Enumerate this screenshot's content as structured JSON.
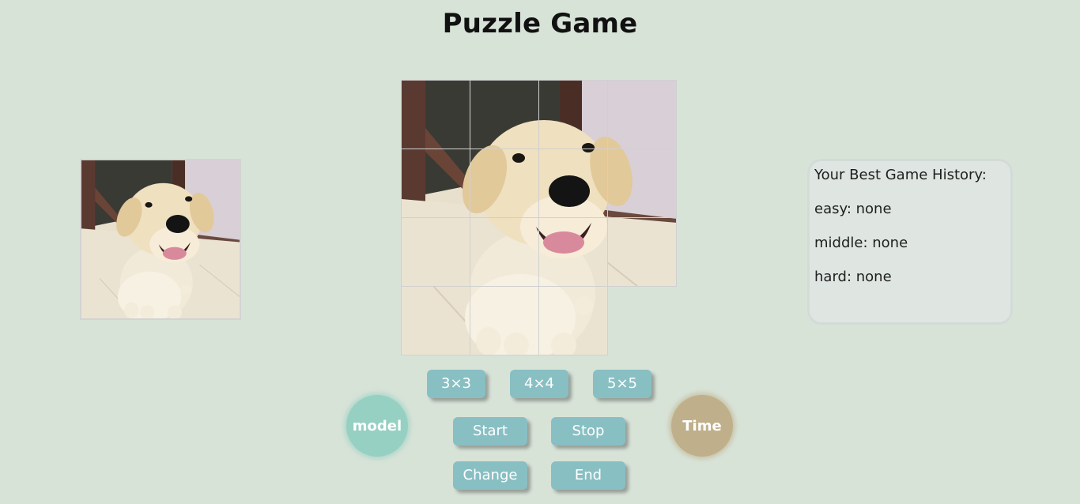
{
  "title": "Puzzle Game",
  "preview": {
    "image": "labrador-puppy-photo"
  },
  "board": {
    "grid": "4x4",
    "empty_tile": "bottom-right",
    "image": "labrador-puppy-photo"
  },
  "history": {
    "heading": "Your Best Game History:",
    "easy": "easy: none",
    "middle": "middle: none",
    "hard": "hard: none"
  },
  "difficulty": {
    "easy": "3×3",
    "middle": "4×4",
    "hard": "5×5"
  },
  "controls": {
    "start": "Start",
    "stop": "Stop",
    "change": "Change",
    "end": "End"
  },
  "model_label": "model",
  "time_label": "Time",
  "colors": {
    "background": "#d8e3d8",
    "button": "#88bfc3",
    "model": "#96d0c3",
    "time": "#bfb08b"
  }
}
